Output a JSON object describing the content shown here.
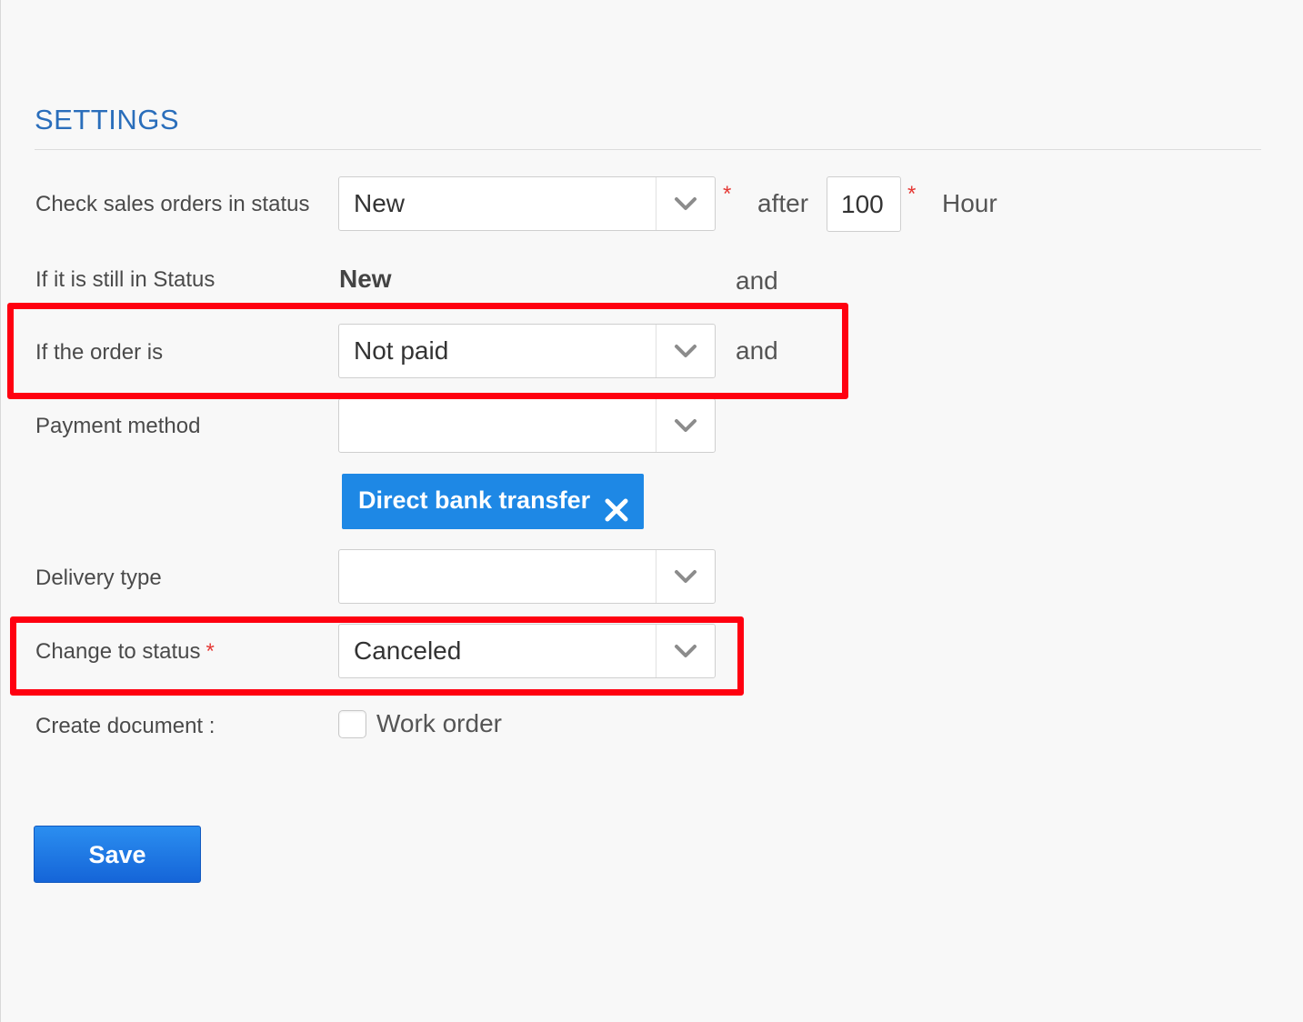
{
  "settings": {
    "title": "SETTINGS"
  },
  "rows": {
    "check_status": {
      "label": "Check sales orders in status",
      "select_value": "New",
      "after_text": "after",
      "hours_value": "100",
      "hour_text": "Hour"
    },
    "still_in_status": {
      "label": "If it is still in Status",
      "value": "New",
      "and_text": "and"
    },
    "order_is": {
      "label": "If the order is",
      "select_value": "Not paid",
      "and_text": "and"
    },
    "payment_method": {
      "label": "Payment method",
      "select_value": "",
      "selected_tag": "Direct bank transfer"
    },
    "delivery_type": {
      "label": "Delivery type",
      "select_value": ""
    },
    "change_status": {
      "label": "Change to status",
      "select_value": "Canceled"
    },
    "create_document": {
      "label": "Create document :",
      "checkbox_label": "Work order",
      "checked": false
    }
  },
  "required_marker": "*",
  "save_label": "Save",
  "colors": {
    "accent": "#1e88e5",
    "title": "#2a6ebb",
    "required": "#e53935",
    "highlight": "#ff0010"
  }
}
